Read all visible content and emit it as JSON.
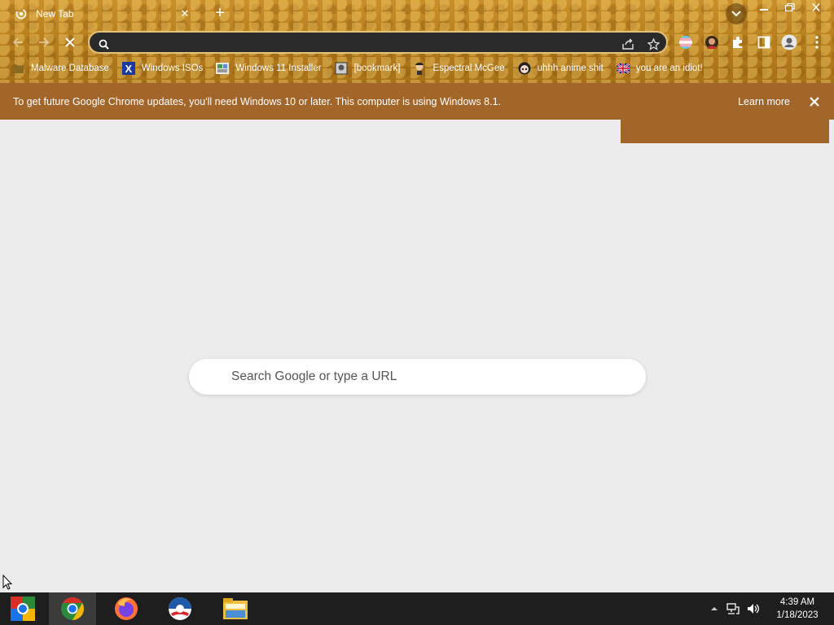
{
  "tab": {
    "title": "New Tab",
    "close_glyph": "✕"
  },
  "tabstrip": {
    "new_tab_glyph": "+",
    "tab_search_icon": "chevron-down-icon"
  },
  "window_controls": [
    "minimize-icon",
    "restore-icon",
    "close-icon"
  ],
  "toolbar": {
    "back_icon": "arrow-left-icon",
    "forward_icon": "arrow-right-icon",
    "stop_icon": "close-icon",
    "omnibox_value": "",
    "omnibox_icons": [
      "search-icon",
      "share-icon",
      "star-icon"
    ],
    "extensions": [
      "flag-extension-icon",
      "avatar-extension-icon",
      "puzzle-icon",
      "side-panel-icon",
      "profile-icon",
      "kebab-menu-icon"
    ]
  },
  "bookmarks": [
    {
      "label": "Malware Database",
      "icon": "folder-icon"
    },
    {
      "label": "Windows ISOs",
      "icon": "x-logo-icon"
    },
    {
      "label": "Windows 11 Installer",
      "icon": "image-icon"
    },
    {
      "label": "[bookmark]",
      "icon": "thumbnail-icon"
    },
    {
      "label": "Espectral McGee",
      "icon": "character-icon"
    },
    {
      "label": "uhhh anime shit",
      "icon": "anime-face-icon"
    },
    {
      "label": "you are an idiot!",
      "icon": "uk-flag-icon"
    }
  ],
  "info_bar": {
    "message": "To get future Google Chrome updates, you'll need Windows 10 or later. This computer is using Windows 8.1.",
    "learn_more": "Learn more",
    "close_glyph": "✕"
  },
  "ntp": {
    "search_placeholder": "Search Google or type a URL"
  },
  "taskbar": {
    "apps": [
      "chrome-app-icon",
      "chrome-icon",
      "firefox-icon",
      "obama-logo-icon",
      "file-explorer-icon"
    ],
    "tray": [
      "chevron-up-icon",
      "network-icon",
      "volume-icon"
    ],
    "time": "4:39 AM",
    "date": "1/18/2023"
  },
  "colors": {
    "theme_gold": "#b8801e",
    "info_bar": "#a3662a",
    "ntp_bg": "#ececec",
    "taskbar": "#1e1e1e"
  }
}
